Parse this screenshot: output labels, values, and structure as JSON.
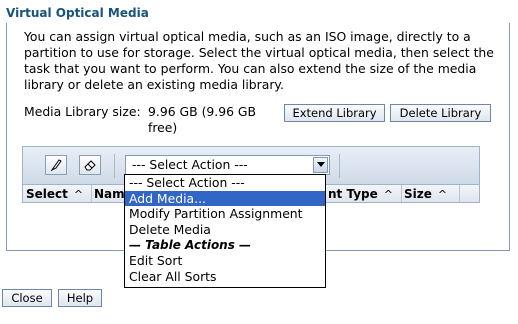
{
  "section": {
    "title": "Virtual Optical Media"
  },
  "intro_text": "You can assign virtual optical media, such as an ISO image, directly to a partition to use for storage. Select the virtual optical media, then select the task that you want to perform. You can also extend the size of the media library or delete an existing media library.",
  "library": {
    "size_label": "Media Library size:",
    "size_value": "9.96 GB (9.96 GB free)",
    "extend_button": "Extend Library",
    "delete_button": "Delete Library"
  },
  "toolbar": {
    "icons": [
      "select-all-icon",
      "deselect-all-icon"
    ],
    "select_value": "--- Select Action ---"
  },
  "table": {
    "columns": [
      {
        "label": "Select",
        "sort": "^"
      },
      {
        "label": "Nam",
        "sort": ""
      },
      {
        "label": "nt Type",
        "sort": "^"
      },
      {
        "label": "Size",
        "sort": "^"
      }
    ]
  },
  "dropdown": {
    "items": [
      {
        "label": "--- Select Action ---",
        "selected": false
      },
      {
        "label": "Add Media...",
        "selected": true
      },
      {
        "label": "Modify Partition Assignment",
        "selected": false
      },
      {
        "label": "Delete Media",
        "selected": false
      }
    ],
    "category": "— Table Actions —",
    "table_items": [
      "Edit Sort",
      "Clear All Sorts"
    ]
  },
  "footer": {
    "close_button": "Close",
    "help_button": "Help"
  },
  "colors": {
    "title": "#16537e",
    "selected": "#3165c6"
  }
}
